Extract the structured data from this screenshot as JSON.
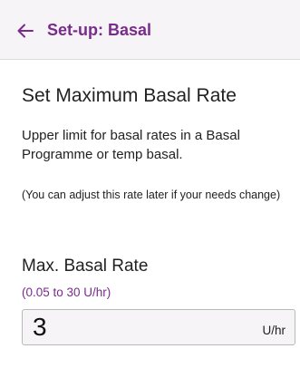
{
  "header": {
    "title": "Set-up: Basal",
    "back_icon": "arrow-left-icon"
  },
  "main": {
    "section_title": "Set Maximum Basal Rate",
    "description": "Upper limit for basal rates in a Basal Programme or temp basal.",
    "note": "(You can adjust this rate later if your needs change)",
    "field": {
      "label": "Max. Basal Rate",
      "range": "(0.05 to 30 U/hr)",
      "value": "3",
      "unit": "U/hr"
    }
  },
  "colors": {
    "accent": "#7a2a8c",
    "header_bg": "#f6f4f7",
    "text": "#222222"
  }
}
